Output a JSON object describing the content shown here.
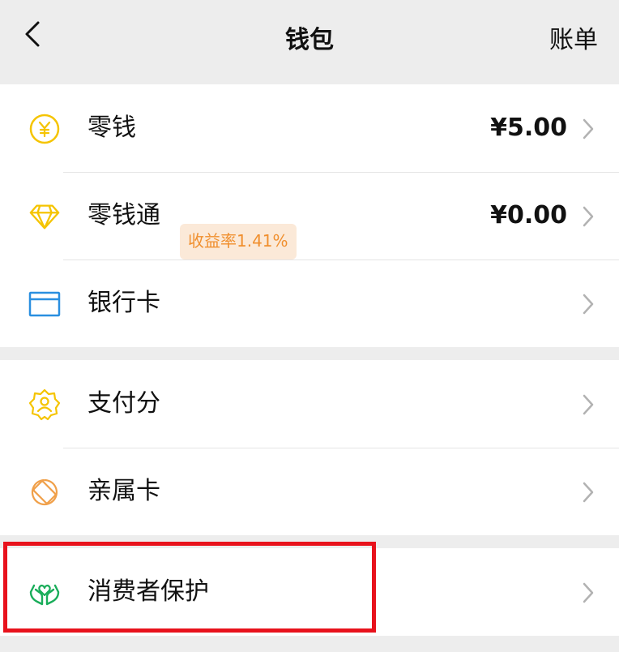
{
  "header": {
    "title": "钱包",
    "right_link": "账单",
    "back_icon": "chevron-left-icon"
  },
  "groups": [
    {
      "items": [
        {
          "label": "零钱",
          "value": "¥5.00",
          "icon": "yuan-coin-icon",
          "icon_color": "#f5c400"
        },
        {
          "label": "零钱通",
          "badge": "收益率1.41%",
          "value": "¥0.00",
          "icon": "diamond-icon",
          "icon_color": "#f5c400"
        },
        {
          "label": "银行卡",
          "icon": "card-icon",
          "icon_color": "#2a8fe0"
        }
      ]
    },
    {
      "items": [
        {
          "label": "支付分",
          "icon": "credit-score-icon",
          "icon_color": "#f5c400"
        },
        {
          "label": "亲属卡",
          "icon": "family-card-icon",
          "icon_color": "#f0a04a"
        }
      ]
    },
    {
      "items": [
        {
          "label": "消费者保护",
          "icon": "protection-hands-icon",
          "icon_color": "#1aad5a",
          "highlighted": true
        }
      ]
    }
  ],
  "colors": {
    "background": "#ededed",
    "badge_bg": "#fbe9d8",
    "badge_text": "#f08f2e",
    "highlight": "#e8121c"
  }
}
